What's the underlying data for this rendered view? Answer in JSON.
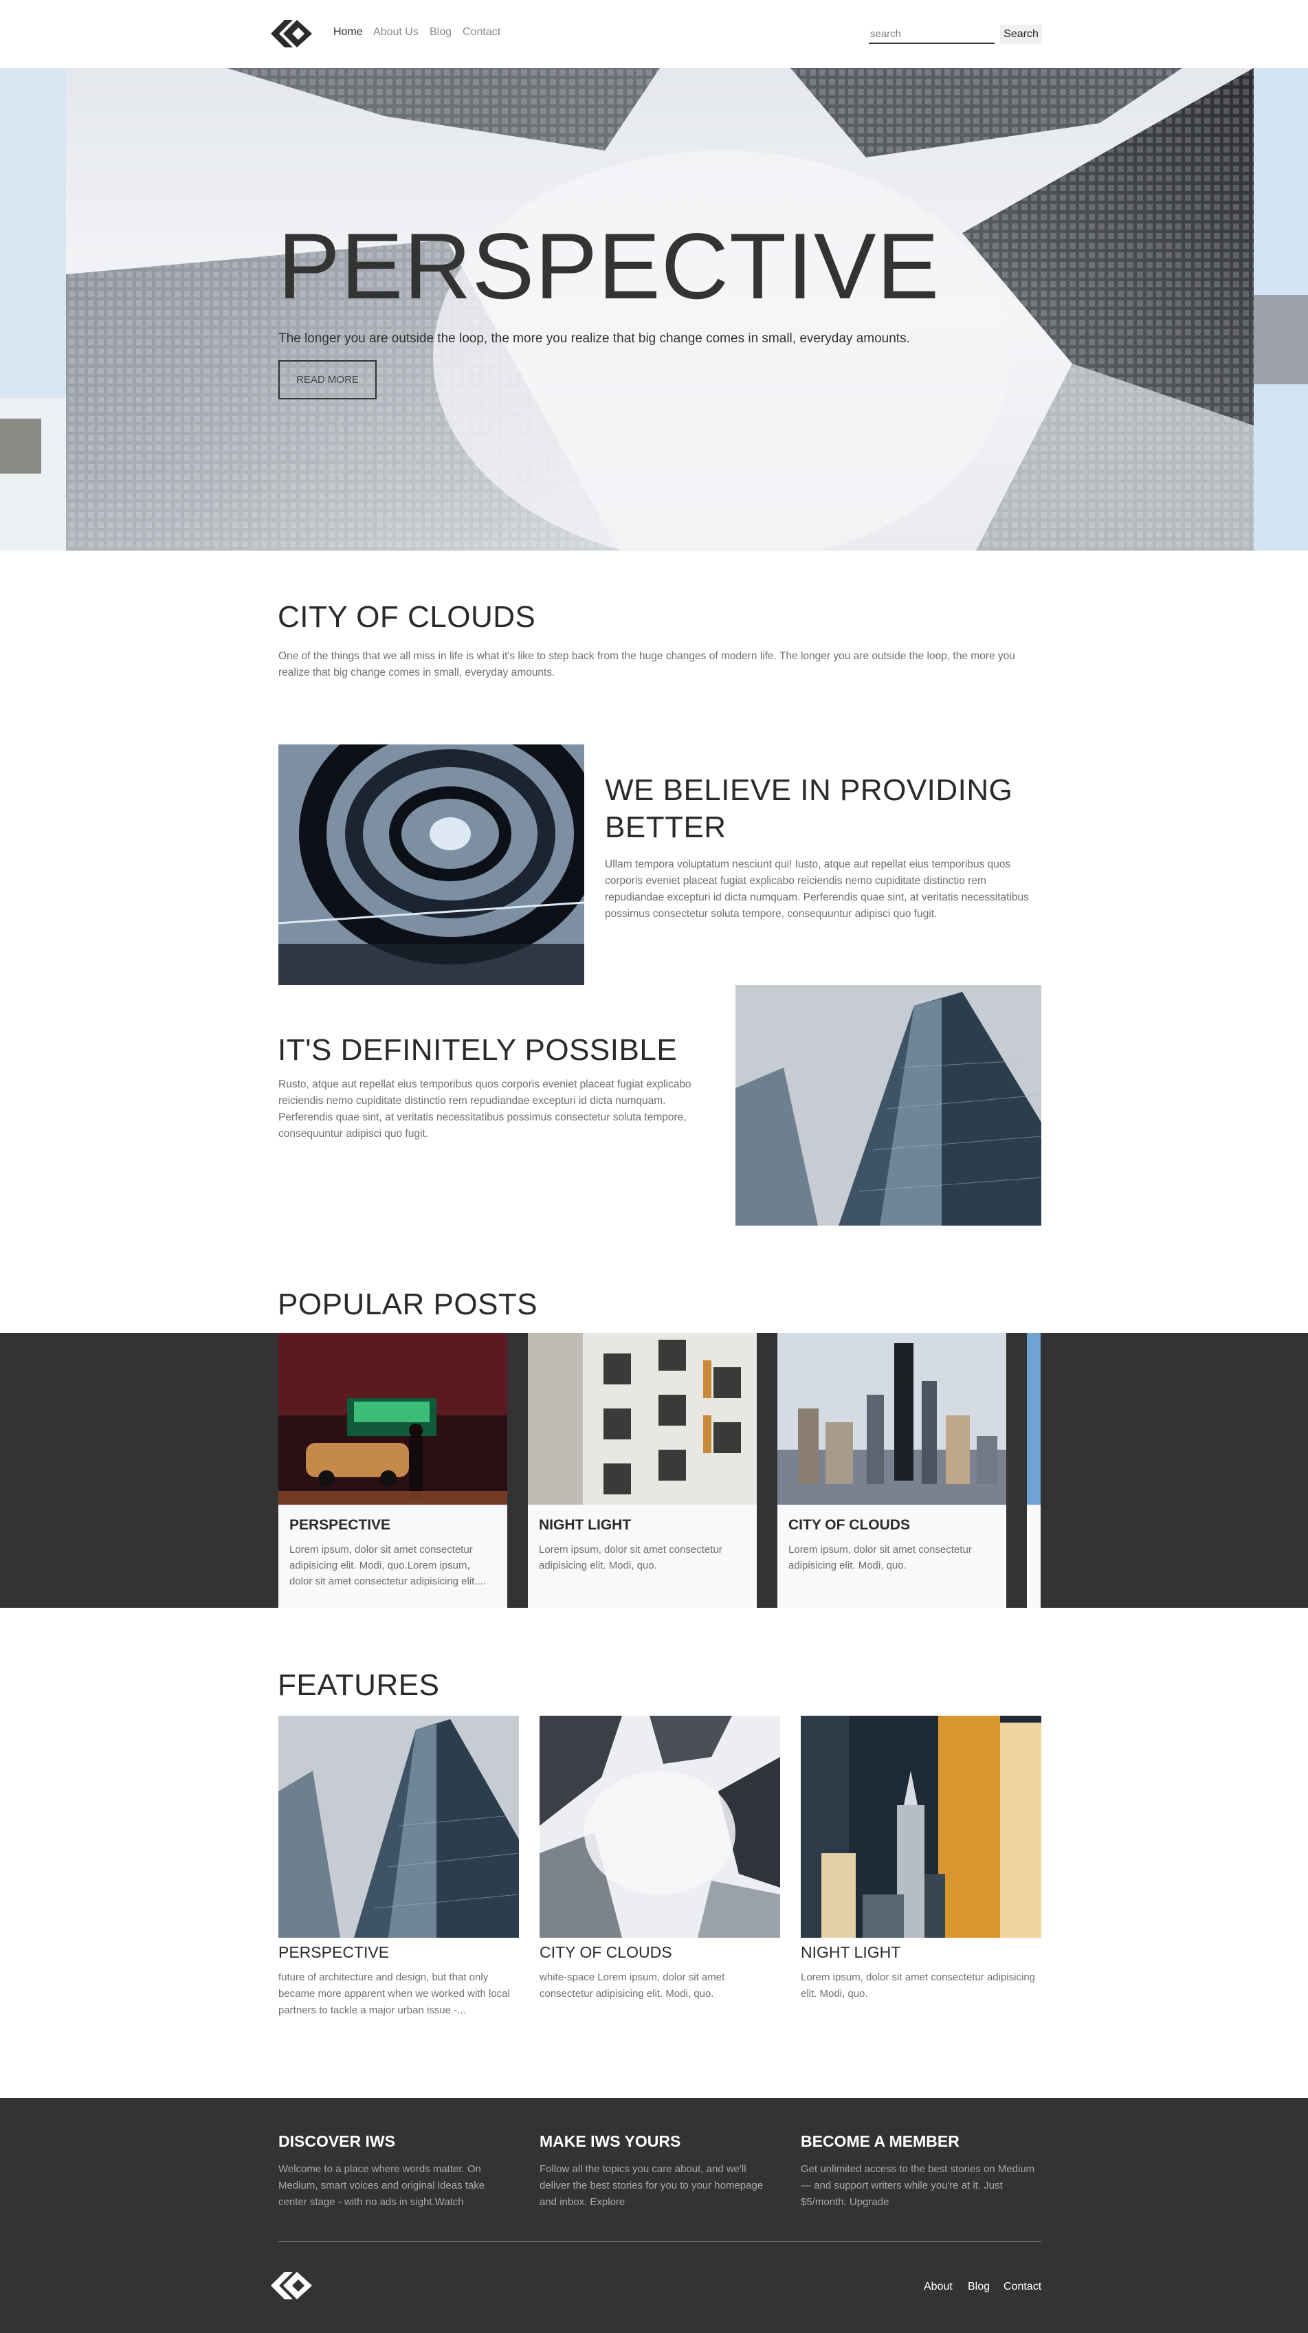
{
  "nav": {
    "links": [
      "Home",
      "About Us",
      "Blog",
      "Contact"
    ],
    "search_placeholder": "search",
    "search_button": "Search"
  },
  "hero": {
    "title": "PERSPECTIVE",
    "subtitle": "The longer you are outside the loop, the more you realize that big change comes in small, everyday amounts.",
    "button": "READ MORE"
  },
  "city": {
    "title": "CITY OF CLOUDS",
    "text": "One of the things that we all miss in life is what it's like to step back from the huge changes of modern life. The longer you are outside the loop, the more you realize that big change comes in small, everyday amounts."
  },
  "believe": {
    "title": "WE BELIEVE IN PROVIDING BETTER",
    "text": "Ullam tempora voluptatum nesciunt qui! Iusto, atque aut repellat eius temporibus quos corporis eveniet placeat fugiat explicabo reiciendis nemo cupiditate distinctio rem repudiandae excepturi id dicta numquam. Perferendis quae sint, at veritatis necessitatibus possimus consectetur soluta tempore, consequuntur adipisci quo fugit."
  },
  "possible": {
    "title": "IT'S DEFINITELY POSSIBLE",
    "text": "Rusto, atque aut repellat eius temporibus quos corporis eveniet placeat fugiat explicabo reiciendis nemo cupiditate distinctio rem repudiandae excepturi id dicta numquam. Perferendis quae sint, at veritatis necessitatibus possimus consectetur soluta tempore, consequuntur adipisci quo fugit."
  },
  "popular": {
    "title": "POPULAR POSTS",
    "posts": [
      {
        "title": "PERSPECTIVE",
        "text": "Lorem ipsum, dolor sit amet consectetur adipisicing elit. Modi, quo.Lorem ipsum, dolor sit amet consectetur adipisicing elit...."
      },
      {
        "title": "NIGHT LIGHT",
        "text": "Lorem ipsum, dolor sit amet consectetur adipisicing elit. Modi, quo."
      },
      {
        "title": "CITY OF CLOUDS",
        "text": "Lorem ipsum, dolor sit amet consectetur adipisicing elit. Modi, quo."
      }
    ]
  },
  "features": {
    "title": "FEATURES",
    "items": [
      {
        "title": "PERSPECTIVE",
        "text": "future of architecture and design, but that only became more apparent when we worked with local partners to tackle a major urban issue -..."
      },
      {
        "title": "CITY OF CLOUDS",
        "text": "white-space Lorem ipsum, dolor sit amet consectetur adipisicing elit. Modi, quo."
      },
      {
        "title": "NIGHT LIGHT",
        "text": "Lorem ipsum, dolor sit amet consectetur adipisicing elit. Modi, quo."
      }
    ]
  },
  "footer": {
    "columns": [
      {
        "title": "DISCOVER IWS",
        "text": "Welcome to a place where words matter. On Medium, smart voices and original ideas take center stage - with no ads in sight.Watch"
      },
      {
        "title": "MAKE IWS YOURS",
        "text": "Follow all the topics you care about, and we'll deliver the best stories for you to your homepage and inbox. Explore"
      },
      {
        "title": "BECOME A MEMBER",
        "text": "Get unlimited access to the best stories on Medium — and support writers while you're at it. Just $5/month. Upgrade"
      }
    ],
    "links": [
      "About",
      "Blog",
      "Contact"
    ]
  },
  "colors": {
    "dark_band": "#333333",
    "text_dark": "#2a2a2a",
    "text_muted": "#6e6e6e"
  }
}
